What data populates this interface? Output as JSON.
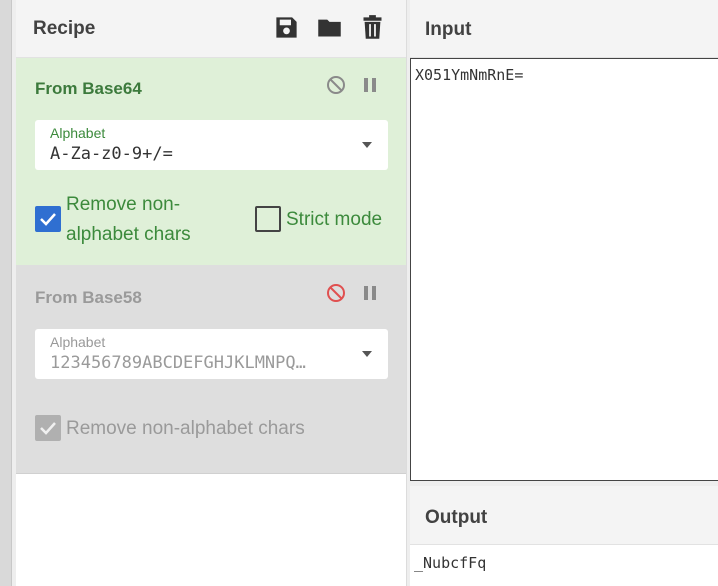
{
  "recipe": {
    "title": "Recipe",
    "icons": [
      "save-icon",
      "folder-icon",
      "trash-icon"
    ],
    "operations": [
      {
        "name": "From Base64",
        "state": "enabled",
        "alphabet_label": "Alphabet",
        "alphabet_value": "A-Za-z0-9+/=",
        "remove_nonalpha_label": "Remove non-alphabet chars",
        "remove_nonalpha_line1": "Remove non-",
        "remove_nonalpha_line2": "alphabet chars",
        "remove_nonalpha_checked": true,
        "strict_mode_label": "Strict mode",
        "strict_mode_checked": false,
        "icons": [
          "disable-icon",
          "pause-icon"
        ]
      },
      {
        "name": "From Base58",
        "state": "disabled",
        "alphabet_label": "Alphabet",
        "alphabet_value": "123456789ABCDEFGHJKLMNPQ…",
        "remove_nonalpha_label": "Remove non-alphabet chars",
        "remove_nonalpha_checked": true,
        "icons": [
          "disable-icon",
          "pause-icon"
        ]
      }
    ]
  },
  "input": {
    "title": "Input",
    "value": "X051YmNmRnE="
  },
  "output": {
    "title": "Output",
    "value": "_NubcfFq"
  },
  "colors": {
    "enabled_bg": "#dff0d8",
    "enabled_text": "#3c7a3c",
    "disabled_bg": "#dedede",
    "disabled_icon_active": "#e05050",
    "checkbox_blue": "#2f6fd1"
  }
}
